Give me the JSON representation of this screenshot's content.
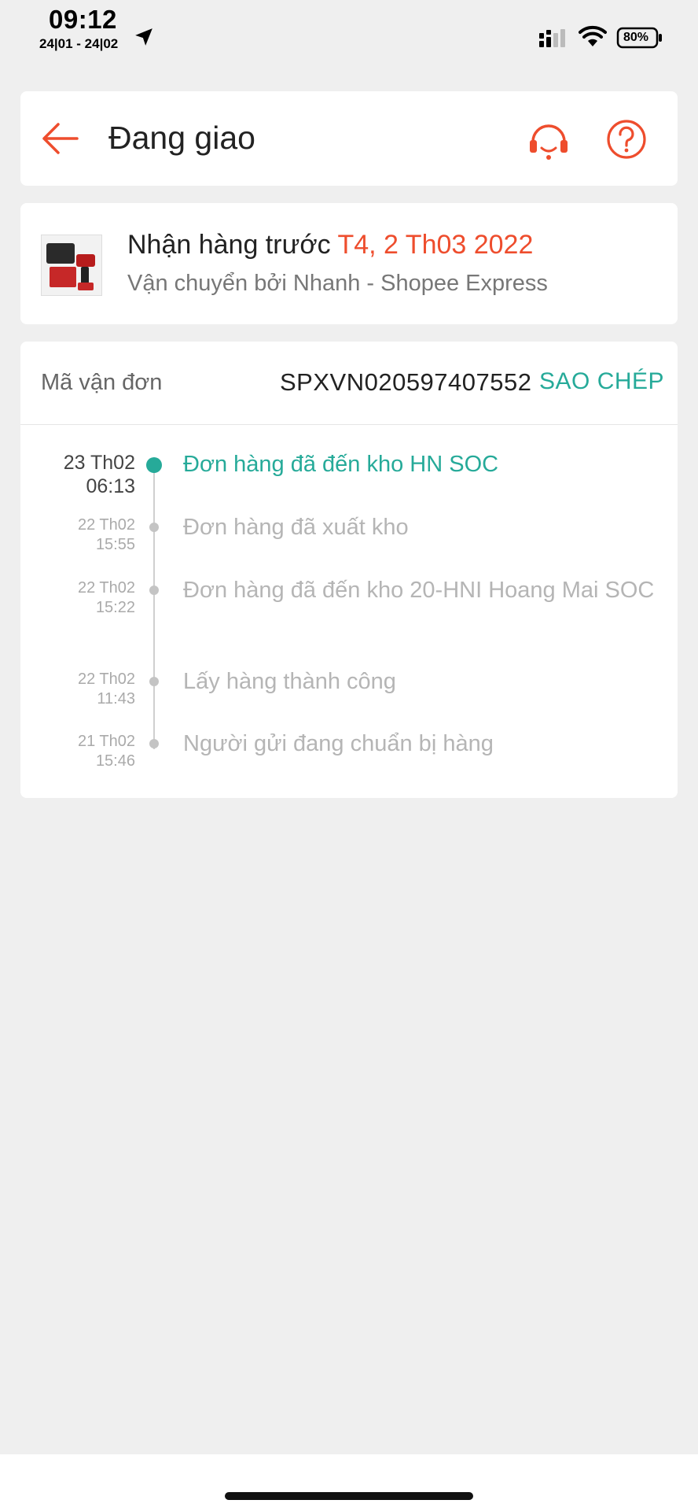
{
  "status_bar": {
    "time": "09:12",
    "date_range": "24|01 - 24|02",
    "battery": "80%"
  },
  "header": {
    "title": "Đang giao",
    "back_icon": "arrow-left-icon",
    "support_icon": "headset-icon",
    "help_icon": "question-circle-icon",
    "accent_color": "#ee4d2d"
  },
  "delivery": {
    "eta_prefix": "Nhận hàng trước",
    "eta_date": "T4, 2 Th03 2022",
    "carrier": "Vận chuyển bởi Nhanh - Shopee Express"
  },
  "tracking": {
    "label": "Mã vận đơn",
    "number": "SPXVN020597407552",
    "copy_label": "SAO CHÉP",
    "copy_color": "#26aa99",
    "events": [
      {
        "date": "23 Th02",
        "time": "06:13",
        "text": "Đơn hàng đã đến kho HN SOC",
        "active": true
      },
      {
        "date": "22 Th02",
        "time": "15:55",
        "text": "Đơn hàng đã xuất kho",
        "active": false
      },
      {
        "date": "22 Th02",
        "time": "15:22",
        "text": "Đơn hàng đã đến kho 20-HNI Hoang Mai SOC",
        "active": false
      },
      {
        "date": "22 Th02",
        "time": "11:43",
        "text": "Lấy hàng thành công",
        "active": false
      },
      {
        "date": "21 Th02",
        "time": "15:46",
        "text": "Người gửi đang chuẩn bị hàng",
        "active": false
      }
    ]
  }
}
